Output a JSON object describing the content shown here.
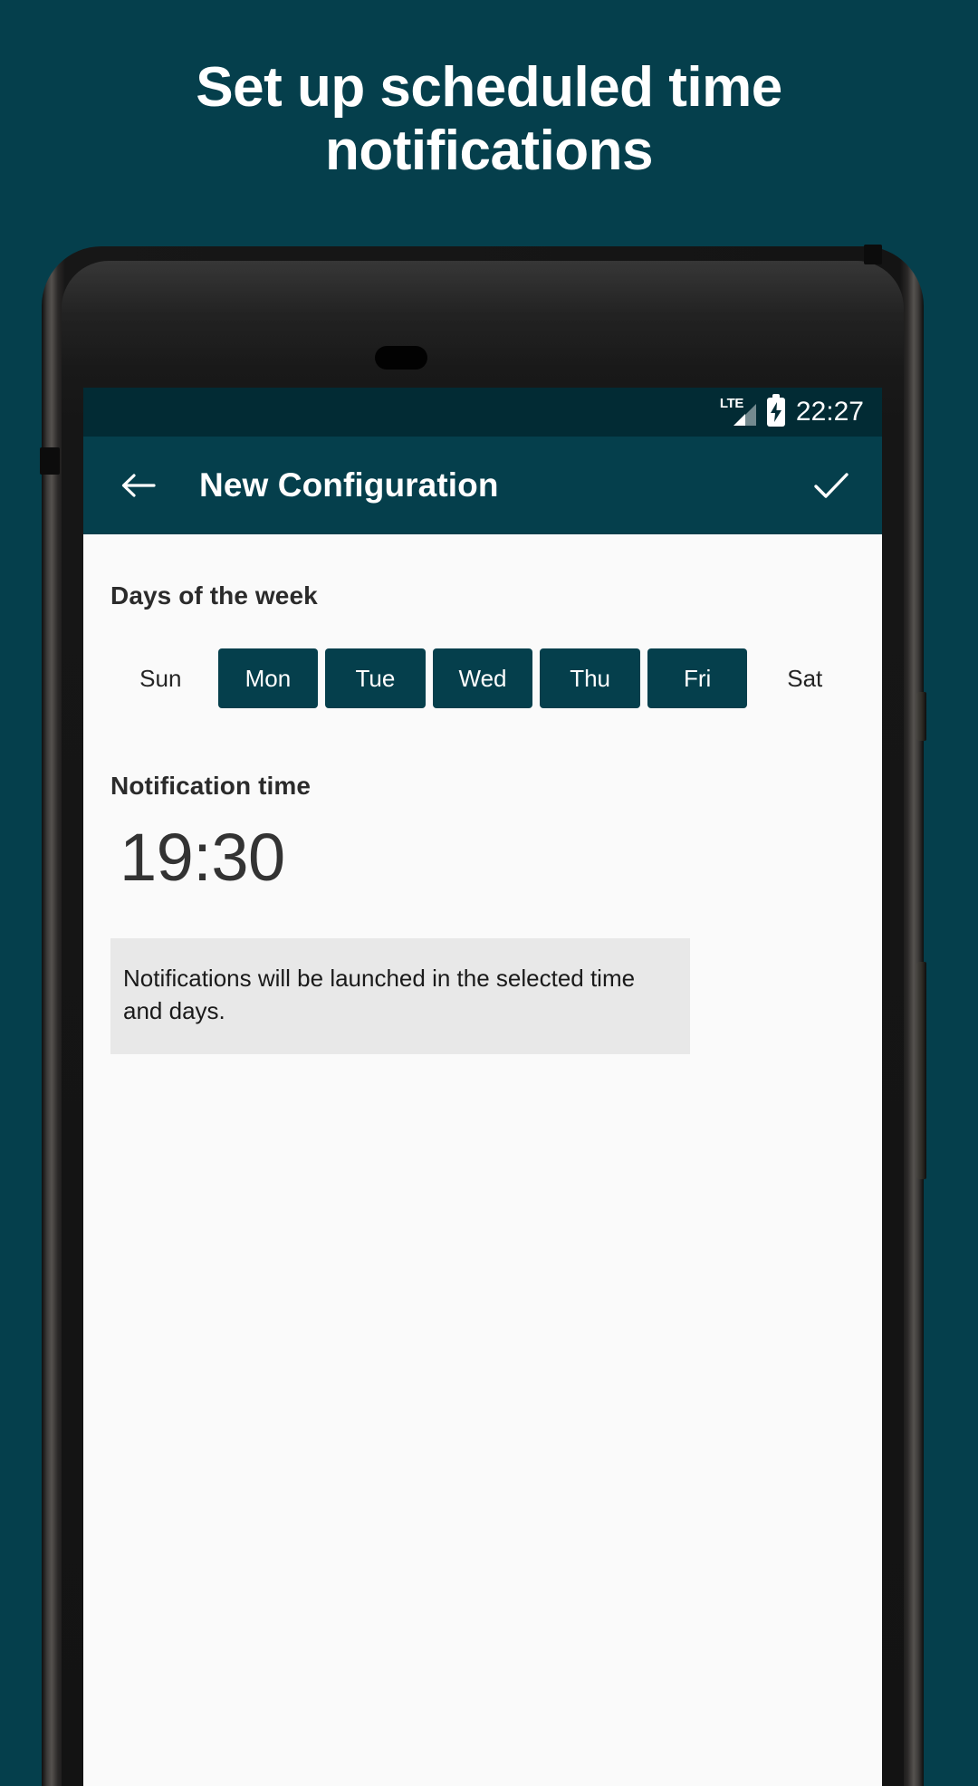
{
  "promo": {
    "headline": "Set up scheduled time\nnotifications",
    "background_color": "#053f4c",
    "text_color": "#ffffff"
  },
  "status_bar": {
    "network_label": "LTE",
    "battery_icon": "battery-charging-icon",
    "signal_icon": "signal-bars-icon",
    "time": "22:27",
    "background_color": "#022b34"
  },
  "app_bar": {
    "back_icon": "back-arrow-icon",
    "title": "New Configuration",
    "confirm_icon": "checkmark-icon",
    "background_color": "#053f4c"
  },
  "screen": {
    "days_section": {
      "label": "Days of the week",
      "days": [
        {
          "label": "Sun",
          "selected": false
        },
        {
          "label": "Mon",
          "selected": true
        },
        {
          "label": "Tue",
          "selected": true
        },
        {
          "label": "Wed",
          "selected": true
        },
        {
          "label": "Thu",
          "selected": true
        },
        {
          "label": "Fri",
          "selected": true
        },
        {
          "label": "Sat",
          "selected": false
        }
      ],
      "selected_chip_color": "#053f4c",
      "selected_text_color": "#ffffff"
    },
    "time_section": {
      "label": "Notification time",
      "value": "19:30"
    },
    "info_banner": {
      "text": "Notifications will be launched in the selected time and days.",
      "background_color": "#e8e8e8"
    }
  },
  "device": {
    "camera_icon": "front-camera-icon",
    "speaker_icon": "earpiece-speaker-icon",
    "sensor_icon": "proximity-sensor-icon",
    "power_button": "power-button",
    "volume_button": "volume-rocker-button"
  }
}
